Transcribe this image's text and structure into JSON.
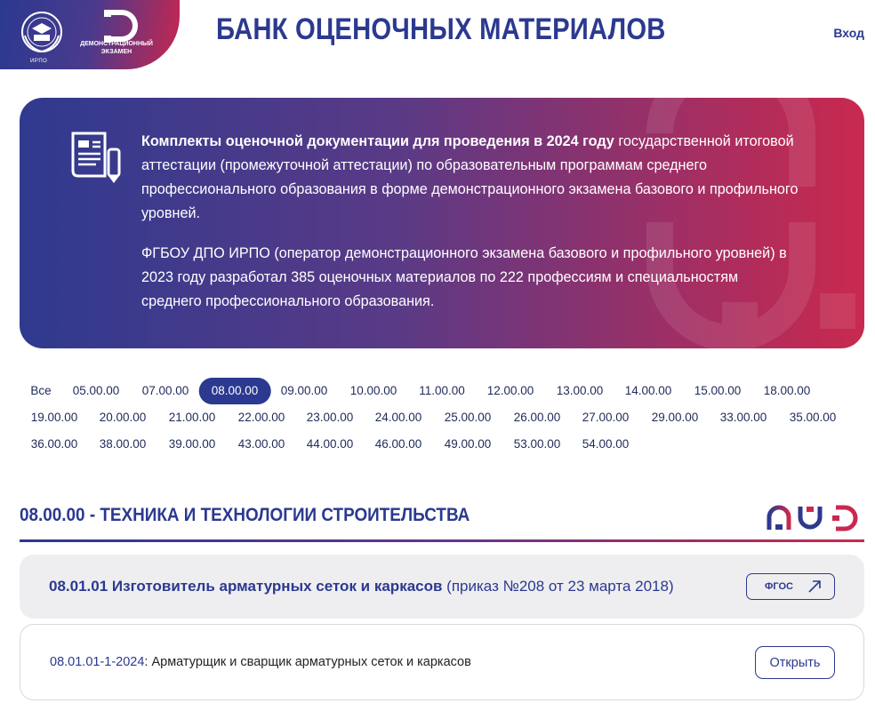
{
  "header": {
    "emblem_caption": "ИРПО",
    "de_logo_text": "ДЕМОНСТРАЦИОННЫЙ ЭКЗАМЕН",
    "title": "БАНК ОЦЕНОЧНЫХ МАТЕРИАЛОВ",
    "login_label": "Вход"
  },
  "banner": {
    "p1_bold": "Комплекты оценочной документации для проведения в 2024 году",
    "p1_rest": " государственной итоговой аттестации (промежуточной аттестации) по образовательным программам среднего профессионального образования в форме демонстрационного экзамена базового и профильного уровней.",
    "p2": "ФГБОУ ДПО ИРПО (оператор демонстрационного экзамена базового и профильного уровней) в 2023 году разработал 385 оценочных материалов по 222 профессиям и специальностям среднего профессионального образования."
  },
  "filters": {
    "active": "08.00.00",
    "items": [
      "Все",
      "05.00.00",
      "07.00.00",
      "08.00.00",
      "09.00.00",
      "10.00.00",
      "11.00.00",
      "12.00.00",
      "13.00.00",
      "14.00.00",
      "15.00.00",
      "18.00.00",
      "19.00.00",
      "20.00.00",
      "21.00.00",
      "22.00.00",
      "23.00.00",
      "24.00.00",
      "25.00.00",
      "26.00.00",
      "27.00.00",
      "29.00.00",
      "33.00.00",
      "35.00.00",
      "36.00.00",
      "38.00.00",
      "39.00.00",
      "43.00.00",
      "44.00.00",
      "46.00.00",
      "49.00.00",
      "53.00.00",
      "54.00.00"
    ]
  },
  "section": {
    "title": "08.00.00 - ТЕХНИКА И ТЕХНОЛОГИИ СТРОИТЕЛЬСТВА"
  },
  "profession": {
    "title_bold": "08.01.01 Изготовитель арматурных сеток и каркасов",
    "title_rest": " (приказ №208 от 23 марта 2018)",
    "fgos_label": "ФГОС"
  },
  "material": {
    "code": "08.01.01-1-2024",
    "name": ": Арматурщик и сварщик арматурных сеток и каркасов",
    "open_label": "Открыть"
  },
  "colors": {
    "brand_blue": "#2b3990",
    "brand_red": "#c9294e"
  }
}
